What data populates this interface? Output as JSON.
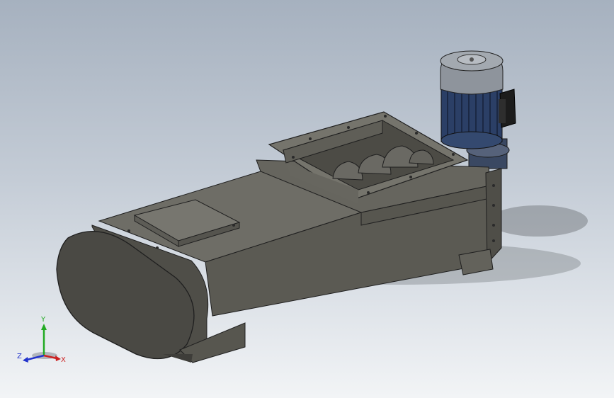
{
  "view": {
    "colors": {
      "background_top": "#a6b1bf",
      "background_bottom": "#f2f4f6",
      "housing": "#5b5a53",
      "housing_dark": "#4a4944",
      "housing_light": "#6e6d66",
      "motor_blue": "#2b3f66",
      "motor_cap": "#8e949c",
      "screw": "#6a6963"
    },
    "model": {
      "components": [
        "trough-housing",
        "end-cap",
        "inspection-hatch",
        "inlet-hopper",
        "screw-flights",
        "drive-flange",
        "electric-motor",
        "terminal-box",
        "outlet-chute"
      ]
    },
    "triad": {
      "x_label": "X",
      "y_label": "Y",
      "z_label": "Z",
      "x_color": "#cc2222",
      "y_color": "#22aa22",
      "z_color": "#2233cc"
    }
  }
}
